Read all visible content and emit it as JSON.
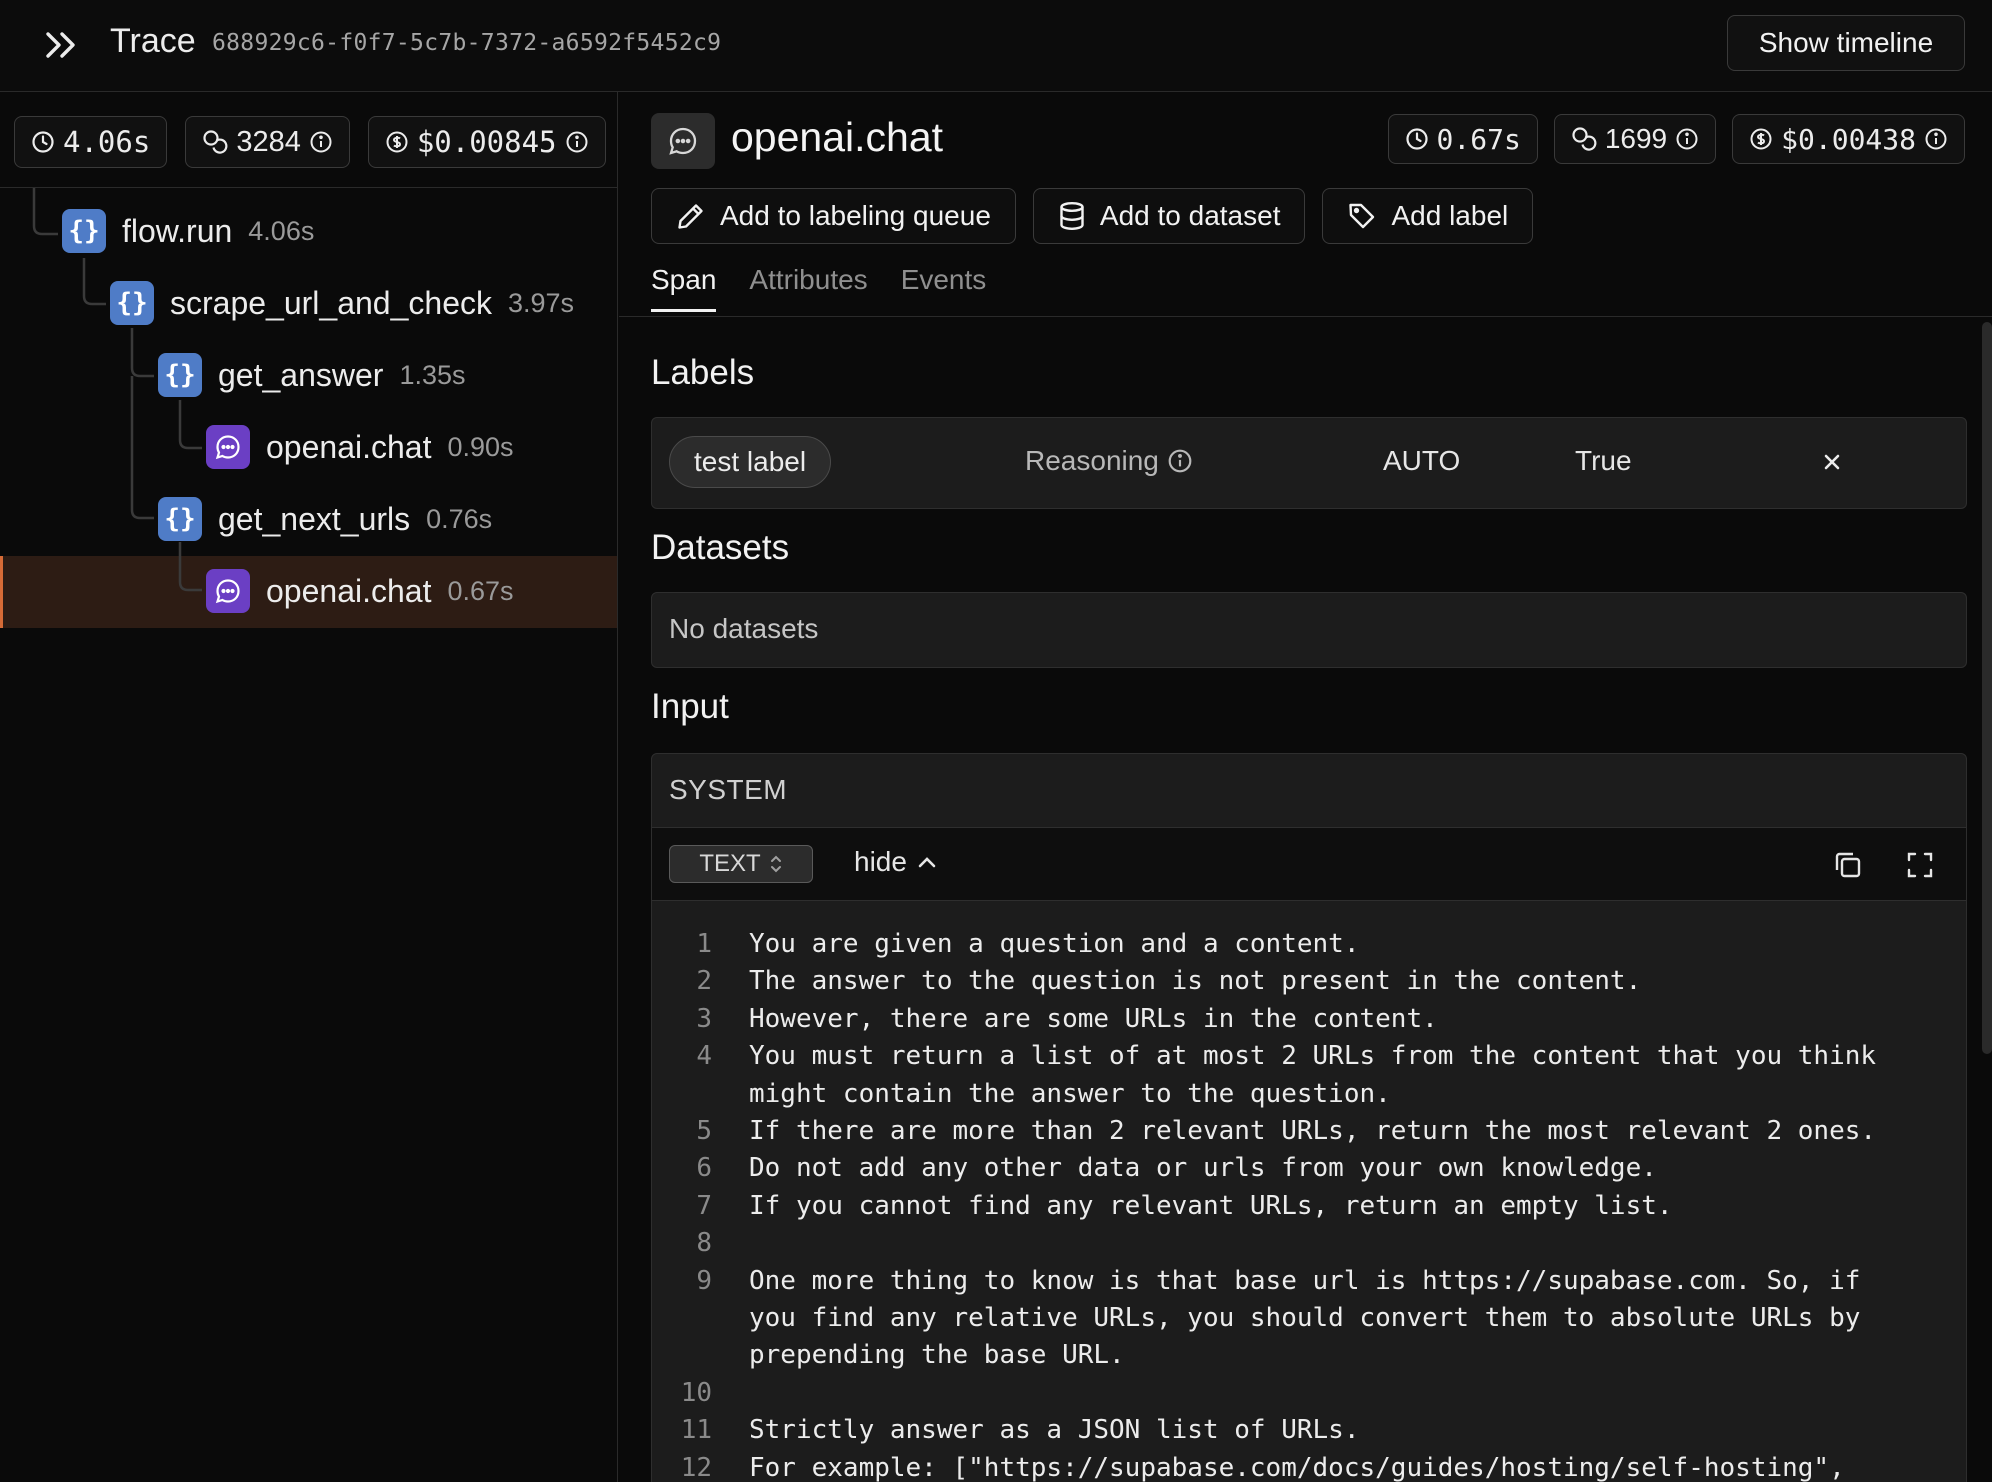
{
  "header": {
    "title": "Trace",
    "trace_id": "688929c6-f0f7-5c7b-7372-a6592f5452c9",
    "timeline_button": "Show timeline"
  },
  "trace_stats": {
    "duration": "4.06s",
    "tokens": "3284",
    "cost": "$0.00845"
  },
  "tree": [
    {
      "name": "flow.run",
      "duration": "4.06s",
      "type": "function"
    },
    {
      "name": "scrape_url_and_check",
      "duration": "3.97s",
      "type": "function"
    },
    {
      "name": "get_answer",
      "duration": "1.35s",
      "type": "function"
    },
    {
      "name": "openai.chat",
      "duration": "0.90s",
      "type": "llm"
    },
    {
      "name": "get_next_urls",
      "duration": "0.76s",
      "type": "function"
    },
    {
      "name": "openai.chat",
      "duration": "0.67s",
      "type": "llm",
      "selected": true
    }
  ],
  "span": {
    "title": "openai.chat",
    "duration": "0.67s",
    "tokens": "1699",
    "cost": "$0.00438"
  },
  "actions": {
    "labeling_queue": "Add to labeling queue",
    "dataset": "Add to dataset",
    "label": "Add label"
  },
  "tabs": [
    "Span",
    "Attributes",
    "Events"
  ],
  "labels_section": {
    "title": "Labels",
    "items": [
      {
        "name": "test label",
        "reasoning": "Reasoning",
        "source": "AUTO",
        "value": "True"
      }
    ]
  },
  "datasets_section": {
    "title": "Datasets",
    "empty_text": "No datasets"
  },
  "input_section": {
    "title": "Input",
    "role": "SYSTEM",
    "format": "TEXT",
    "toggle": "hide",
    "lines": [
      {
        "n": "1",
        "text": "You are given a question and a content."
      },
      {
        "n": "2",
        "text": "The answer to the question is not present in the content."
      },
      {
        "n": "3",
        "text": "However, there are some URLs in the content."
      },
      {
        "n": "4",
        "text": "You must return a list of at most 2 URLs from the content that you think\nmight contain the answer to the question."
      },
      {
        "n": "5",
        "text": "If there are more than 2 relevant URLs, return the most relevant 2 ones."
      },
      {
        "n": "6",
        "text": "Do not add any other data or urls from your own knowledge."
      },
      {
        "n": "7",
        "text": "If you cannot find any relevant URLs, return an empty list."
      },
      {
        "n": "8",
        "text": ""
      },
      {
        "n": "9",
        "text": "One more thing to know is that base url is https://supabase.com. So, if\nyou find any relative URLs, you should convert them to absolute URLs by\nprepending the base URL."
      },
      {
        "n": "10",
        "text": ""
      },
      {
        "n": "11",
        "text": "Strictly answer as a JSON list of URLs."
      },
      {
        "n": "12",
        "text": "For example: [\"https://supabase.com/docs/guides/hosting/self-hosting\","
      }
    ]
  },
  "colors": {
    "background": "#0a0a0a",
    "function_icon": "#4f7cc7",
    "llm_icon": "#6b3fc4",
    "selected_row": "#2d1c14",
    "selected_accent": "#d66b37"
  },
  "icons": {
    "expand": "chevrons-right-icon",
    "duration": "clock-icon",
    "tokens": "coins-icon",
    "cost": "dollar-circle-icon",
    "info": "info-icon",
    "function_span": "braces-icon",
    "llm_span": "message-bubble-icon",
    "labeling_queue": "pen-icon",
    "dataset": "database-icon",
    "label": "tag-icon",
    "remove": "close-icon",
    "copy": "copy-icon",
    "fullscreen": "maximize-icon"
  }
}
